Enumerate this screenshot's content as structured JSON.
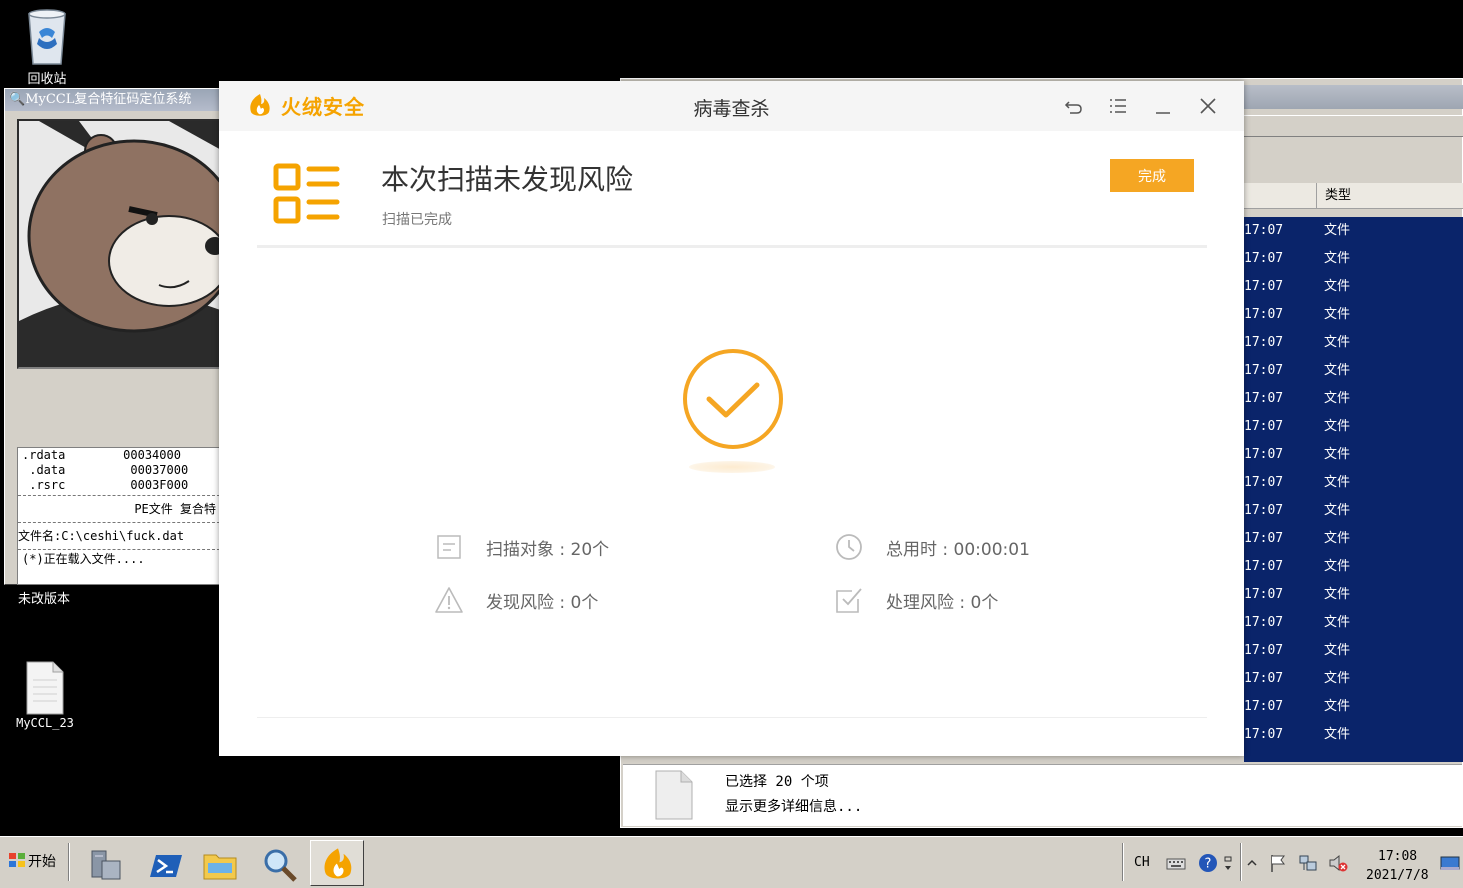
{
  "desktop": {
    "recycle_bin_label": "回收站",
    "file_label": "MyCCL_23",
    "old_version_label": "未改版本"
  },
  "myccl": {
    "title": "MyCCL复合特征码定位系统",
    "sections": [
      {
        "name": ".rdata",
        "addr": "00034000"
      },
      {
        "name": ".data",
        "addr": "00037000"
      },
      {
        "name": ".rsrc",
        "addr": "0003F000"
      }
    ],
    "pe_title": "PE文件 复合特",
    "filename": "文件名:C:\\ceshi\\fuck.dat",
    "loading": "(*)正在载入文件...."
  },
  "explorer": {
    "column_type": "类型",
    "rows": [
      {
        "time": "17:07",
        "type": "文件"
      },
      {
        "time": "17:07",
        "type": "文件"
      },
      {
        "time": "17:07",
        "type": "文件"
      },
      {
        "time": "17:07",
        "type": "文件"
      },
      {
        "time": "17:07",
        "type": "文件"
      },
      {
        "time": "17:07",
        "type": "文件"
      },
      {
        "time": "17:07",
        "type": "文件"
      },
      {
        "time": "17:07",
        "type": "文件"
      },
      {
        "time": "17:07",
        "type": "文件"
      },
      {
        "time": "17:07",
        "type": "文件"
      },
      {
        "time": "17:07",
        "type": "文件"
      },
      {
        "time": "17:07",
        "type": "文件"
      },
      {
        "time": "17:07",
        "type": "文件"
      },
      {
        "time": "17:07",
        "type": "文件"
      },
      {
        "time": "17:07",
        "type": "文件"
      },
      {
        "time": "17:07",
        "type": "文件"
      },
      {
        "time": "17:07",
        "type": "文件"
      },
      {
        "time": "17:07",
        "type": "文件"
      },
      {
        "time": "17:07",
        "type": "文件"
      }
    ],
    "status_selected": "已选择 20 个项",
    "status_more": "显示更多详细信息..."
  },
  "huorong": {
    "brand": "火绒安全",
    "window_title": "病毒查杀",
    "headline": "本次扫描未发现风险",
    "subline": "扫描已完成",
    "done_button": "完成",
    "stats": {
      "scan_objects": "扫描对象 : 20个",
      "total_time": "总用时 : 00:00:01",
      "risks_found": "发现风险 : 0个",
      "risks_handled": "处理风险 : 0个"
    },
    "accent_color": "#f5a623"
  },
  "taskbar": {
    "start_label": "开始",
    "ime": "CH",
    "time": "17:08",
    "date": "2021/7/8"
  }
}
